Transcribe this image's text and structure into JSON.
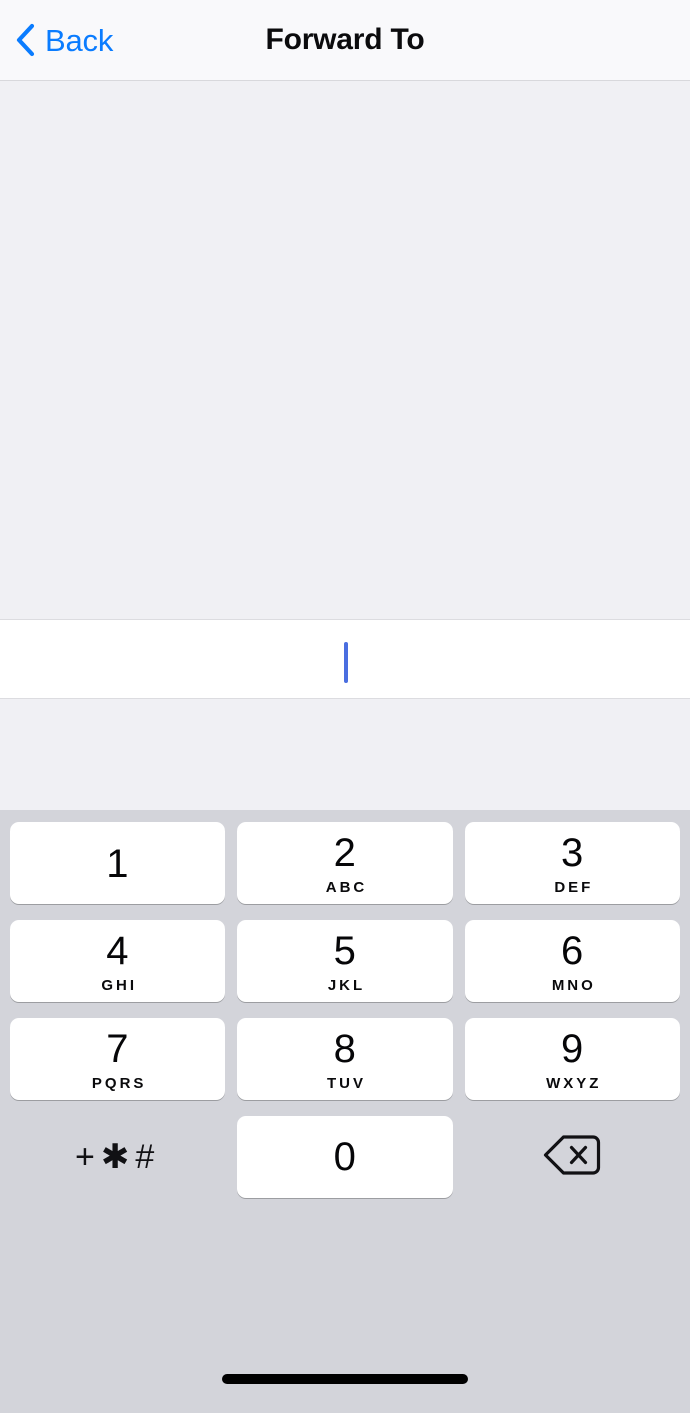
{
  "navbar": {
    "back_label": "Back",
    "title": "Forward To",
    "back_tint": "#0a7cff"
  },
  "text_field": {
    "value": "",
    "placeholder": "",
    "caret_color": "#4a6ee0"
  },
  "keypad": {
    "background": "#d3d4da",
    "key_background": "#ffffff",
    "rows": [
      [
        {
          "type": "digit",
          "digit": "1",
          "letters": ""
        },
        {
          "type": "digit",
          "digit": "2",
          "letters": "ABC"
        },
        {
          "type": "digit",
          "digit": "3",
          "letters": "DEF"
        }
      ],
      [
        {
          "type": "digit",
          "digit": "4",
          "letters": "GHI"
        },
        {
          "type": "digit",
          "digit": "5",
          "letters": "JKL"
        },
        {
          "type": "digit",
          "digit": "6",
          "letters": "MNO"
        }
      ],
      [
        {
          "type": "digit",
          "digit": "7",
          "letters": "PQRS"
        },
        {
          "type": "digit",
          "digit": "8",
          "letters": "TUV"
        },
        {
          "type": "digit",
          "digit": "9",
          "letters": "WXYZ"
        }
      ],
      [
        {
          "type": "symbols",
          "digit": "+✱#",
          "letters": ""
        },
        {
          "type": "digit",
          "digit": "0",
          "letters": ""
        },
        {
          "type": "delete",
          "digit": "",
          "letters": ""
        }
      ]
    ]
  }
}
